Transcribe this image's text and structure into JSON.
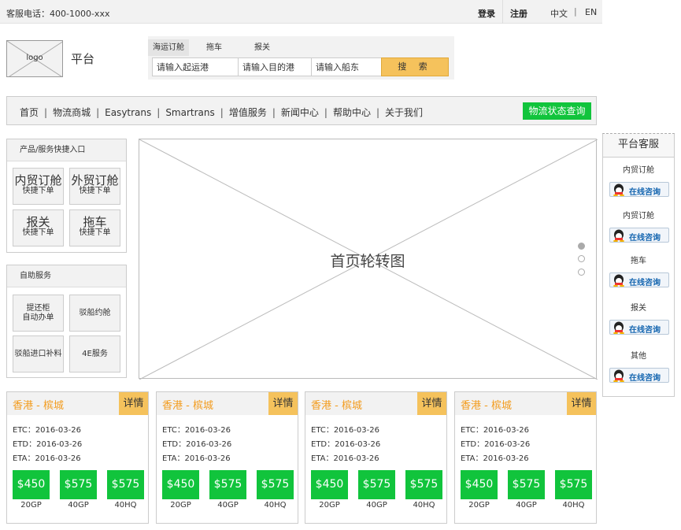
{
  "topbar": {
    "phone": "客服电话：400-1000-xxx",
    "login": "登录",
    "register": "注册",
    "lang_zh": "中文",
    "lang_sep": "|",
    "lang_en": "EN"
  },
  "header": {
    "logo_text": "logo",
    "platform_name": "平台"
  },
  "search": {
    "tabs": [
      "海运订舱",
      "拖车",
      "报关"
    ],
    "origin_placeholder": "请输入起运港",
    "dest_placeholder": "请输入目的港",
    "carrier_placeholder": "请输入船东",
    "button_label": "搜 索"
  },
  "nav": {
    "items": [
      "首页",
      "物流商城",
      "Easytrans",
      "Smartrans",
      "增值服务",
      "新闻中心",
      "帮助中心",
      "关于我们"
    ],
    "status_button": "物流状态查询"
  },
  "quick_entry": {
    "title": "产品/服务快捷入口",
    "tiles": [
      {
        "name": "内贸订舱",
        "sub": "快捷下单"
      },
      {
        "name": "外贸订舱",
        "sub": "快捷下单"
      },
      {
        "name": "报关",
        "sub": "快捷下单"
      },
      {
        "name": "拖车",
        "sub": "快捷下单"
      }
    ]
  },
  "self_service": {
    "title": "自助服务",
    "tiles": [
      {
        "line1": "提还柜",
        "line2": "自动办单"
      },
      {
        "line1": "驳船约舱",
        "line2": ""
      },
      {
        "line1": "驳船进口补料",
        "line2": ""
      },
      {
        "line1": "4E服务",
        "line2": ""
      }
    ]
  },
  "carousel": {
    "title": "首页轮转图"
  },
  "service": {
    "title": "平台客服",
    "button_text": "在线咨询",
    "groups": [
      "内贸订舱",
      "内贸订舱",
      "拖车",
      "报关",
      "其他"
    ]
  },
  "cards": [
    {
      "route": "香港 - 槟城",
      "detail": "详情",
      "etc": "ETC：2016-03-26",
      "etd": "ETD：2016-03-26",
      "eta": "ETA：2016-03-26",
      "prices": [
        "$450",
        "$575",
        "$575"
      ],
      "types": [
        "20GP",
        "40GP",
        "40HQ"
      ]
    },
    {
      "route": "香港 - 槟城",
      "detail": "详情",
      "etc": "ETC：2016-03-26",
      "etd": "ETD：2016-03-26",
      "eta": "ETA：2016-03-26",
      "prices": [
        "$450",
        "$575",
        "$575"
      ],
      "types": [
        "20GP",
        "40GP",
        "40HQ"
      ]
    },
    {
      "route": "香港 - 槟城",
      "detail": "详情",
      "etc": "ETC：2016-03-26",
      "etd": "ETD：2016-03-26",
      "eta": "ETA：2016-03-26",
      "prices": [
        "$450",
        "$575",
        "$575"
      ],
      "types": [
        "20GP",
        "40GP",
        "40HQ"
      ]
    },
    {
      "route": "香港 - 槟城",
      "detail": "详情",
      "etc": "ETC：2016-03-26",
      "etd": "ETD：2016-03-26",
      "eta": "ETA：2016-03-26",
      "prices": [
        "$450",
        "$575",
        "$575"
      ],
      "types": [
        "20GP",
        "40GP",
        "40HQ"
      ]
    }
  ],
  "colors": {
    "accent_green": "#11c43c",
    "accent_yellow": "#f5c25c",
    "route_orange": "#f39c1e",
    "qq_blue": "#1566b0"
  }
}
